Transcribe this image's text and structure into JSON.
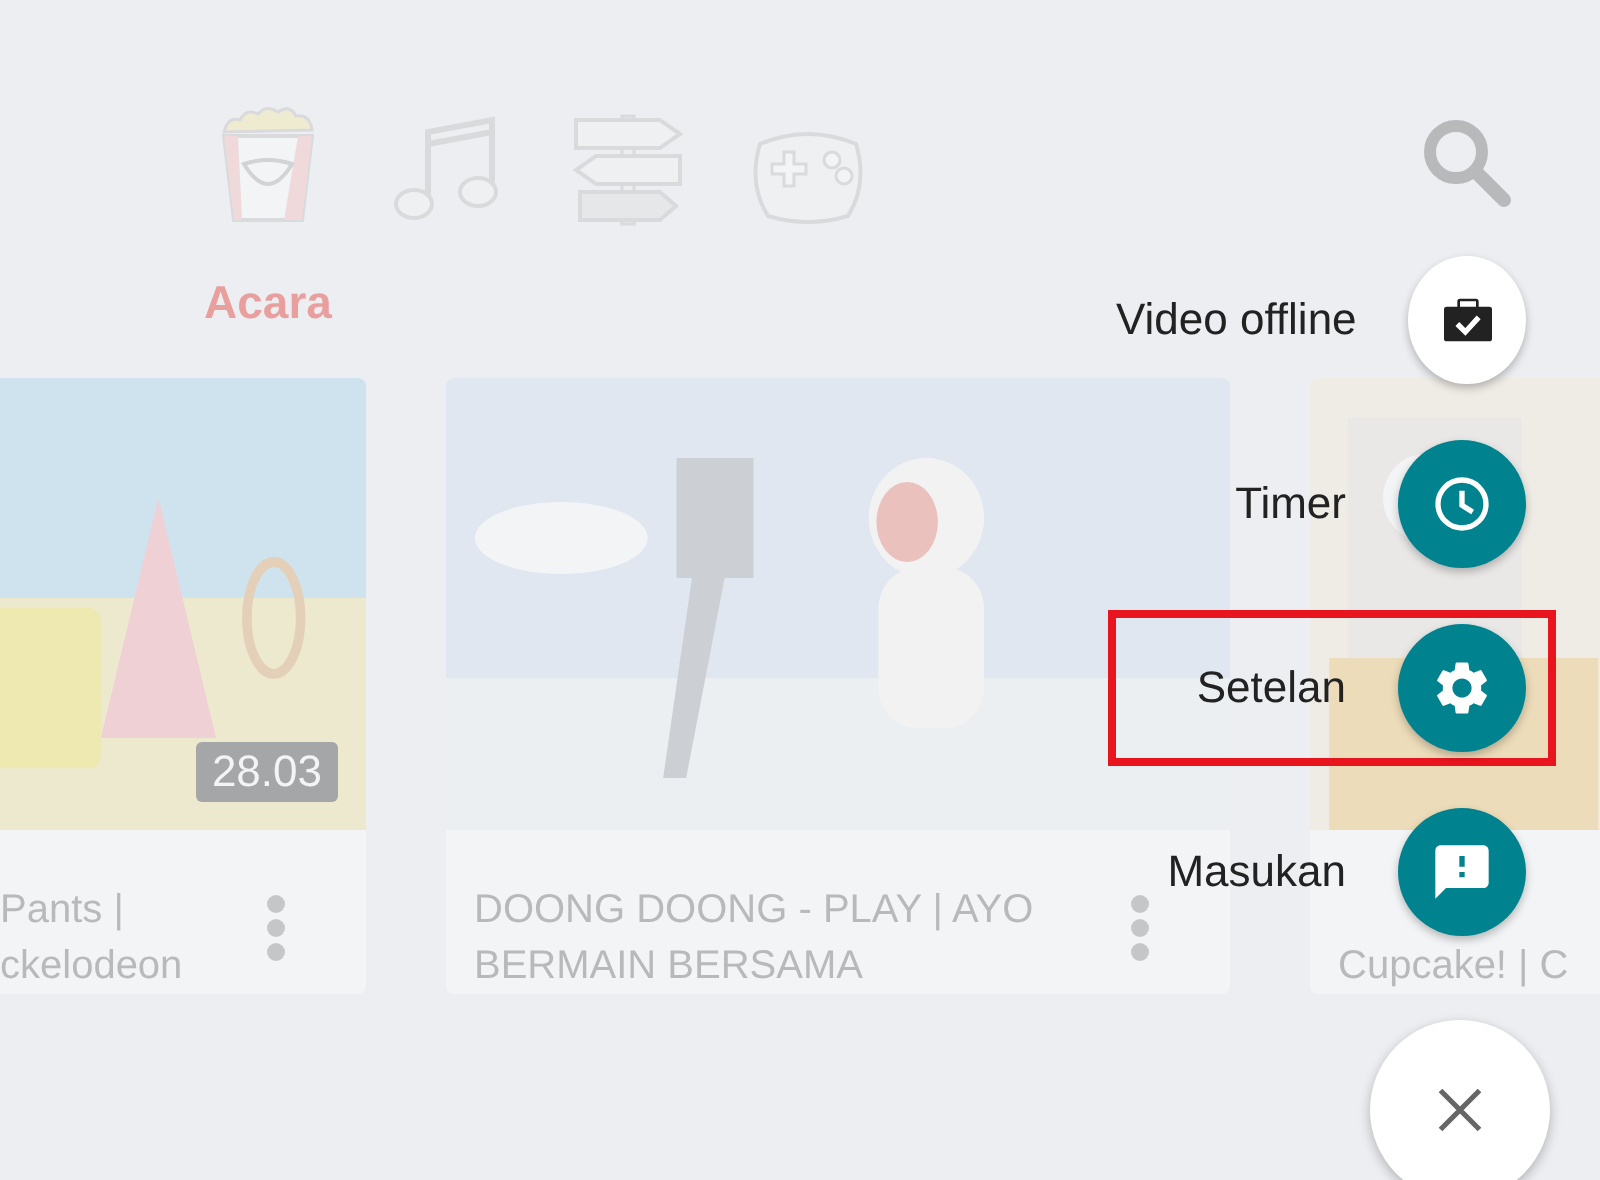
{
  "tabs": [
    {
      "kind": "popcorn",
      "label": "Acara",
      "selected": true
    },
    {
      "kind": "music",
      "selected": false
    },
    {
      "kind": "signpost",
      "selected": false
    },
    {
      "kind": "gamepad",
      "selected": false
    }
  ],
  "cards": [
    {
      "kind": "beach",
      "title_lines": [
        "Pants |",
        "ckelodeon"
      ],
      "duration": "28.03"
    },
    {
      "kind": "sky",
      "title_lines": [
        "DOONG DOONG - PLAY | AYO",
        "BERMAIN BERSAMA"
      ]
    },
    {
      "kind": "room",
      "title_lines": [
        "Cupcake! | C"
      ]
    }
  ],
  "menu": {
    "items": [
      {
        "label": "Video offline",
        "kind": "offline",
        "highlighted": false
      },
      {
        "label": "Timer",
        "kind": "timer",
        "highlighted": false
      },
      {
        "label": "Setelan",
        "kind": "settings",
        "highlighted": true
      },
      {
        "label": "Masukan",
        "kind": "feedback",
        "highlighted": false
      }
    ]
  }
}
